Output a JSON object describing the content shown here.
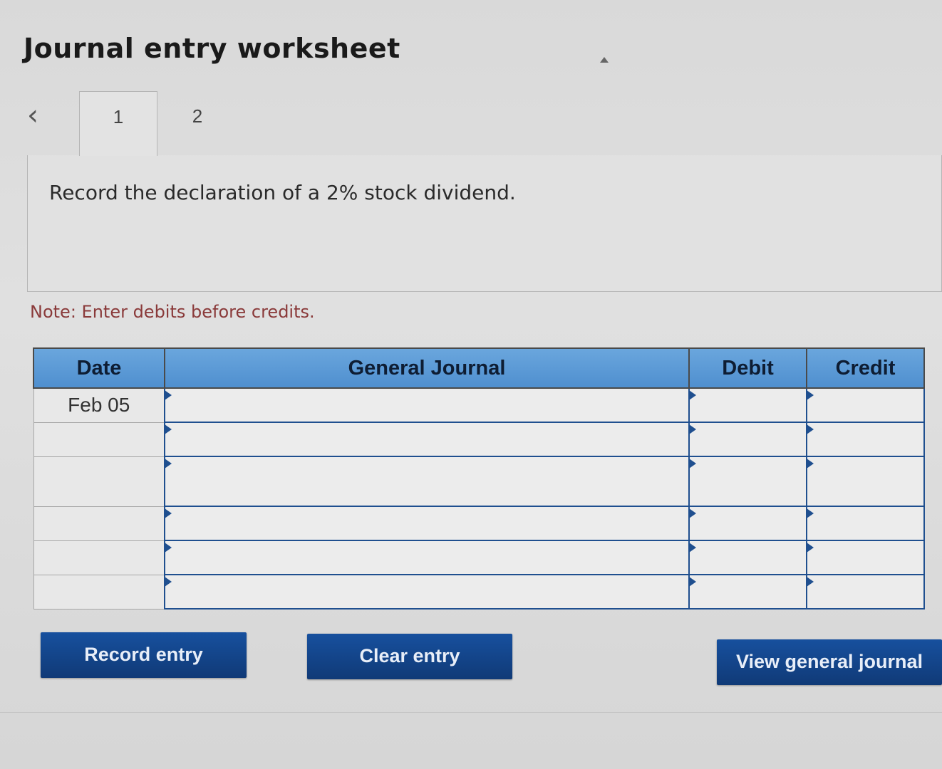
{
  "title": "Journal entry worksheet",
  "navigation": {
    "prev_icon": "chevron-left-icon",
    "tabs": [
      {
        "label": "1",
        "active": true
      },
      {
        "label": "2",
        "active": false
      }
    ]
  },
  "question": "Record the declaration of a 2% stock dividend.",
  "note": "Note: Enter debits before credits.",
  "table": {
    "headers": {
      "date": "Date",
      "journal": "General Journal",
      "debit": "Debit",
      "credit": "Credit"
    },
    "rows": [
      {
        "date": "Feb 05",
        "journal": "",
        "debit": "",
        "credit": ""
      },
      {
        "date": "",
        "journal": "",
        "debit": "",
        "credit": ""
      },
      {
        "date": "",
        "journal": "",
        "debit": "",
        "credit": ""
      },
      {
        "date": "",
        "journal": "",
        "debit": "",
        "credit": ""
      },
      {
        "date": "",
        "journal": "",
        "debit": "",
        "credit": ""
      },
      {
        "date": "",
        "journal": "",
        "debit": "",
        "credit": ""
      }
    ]
  },
  "buttons": {
    "record": "Record entry",
    "clear": "Clear entry",
    "view": "View general journal"
  },
  "colors": {
    "header_bg": "#5b9bd5",
    "button_bg": "#14448a",
    "field_border": "#1f4f8f",
    "note_text": "#8a3a3a"
  }
}
